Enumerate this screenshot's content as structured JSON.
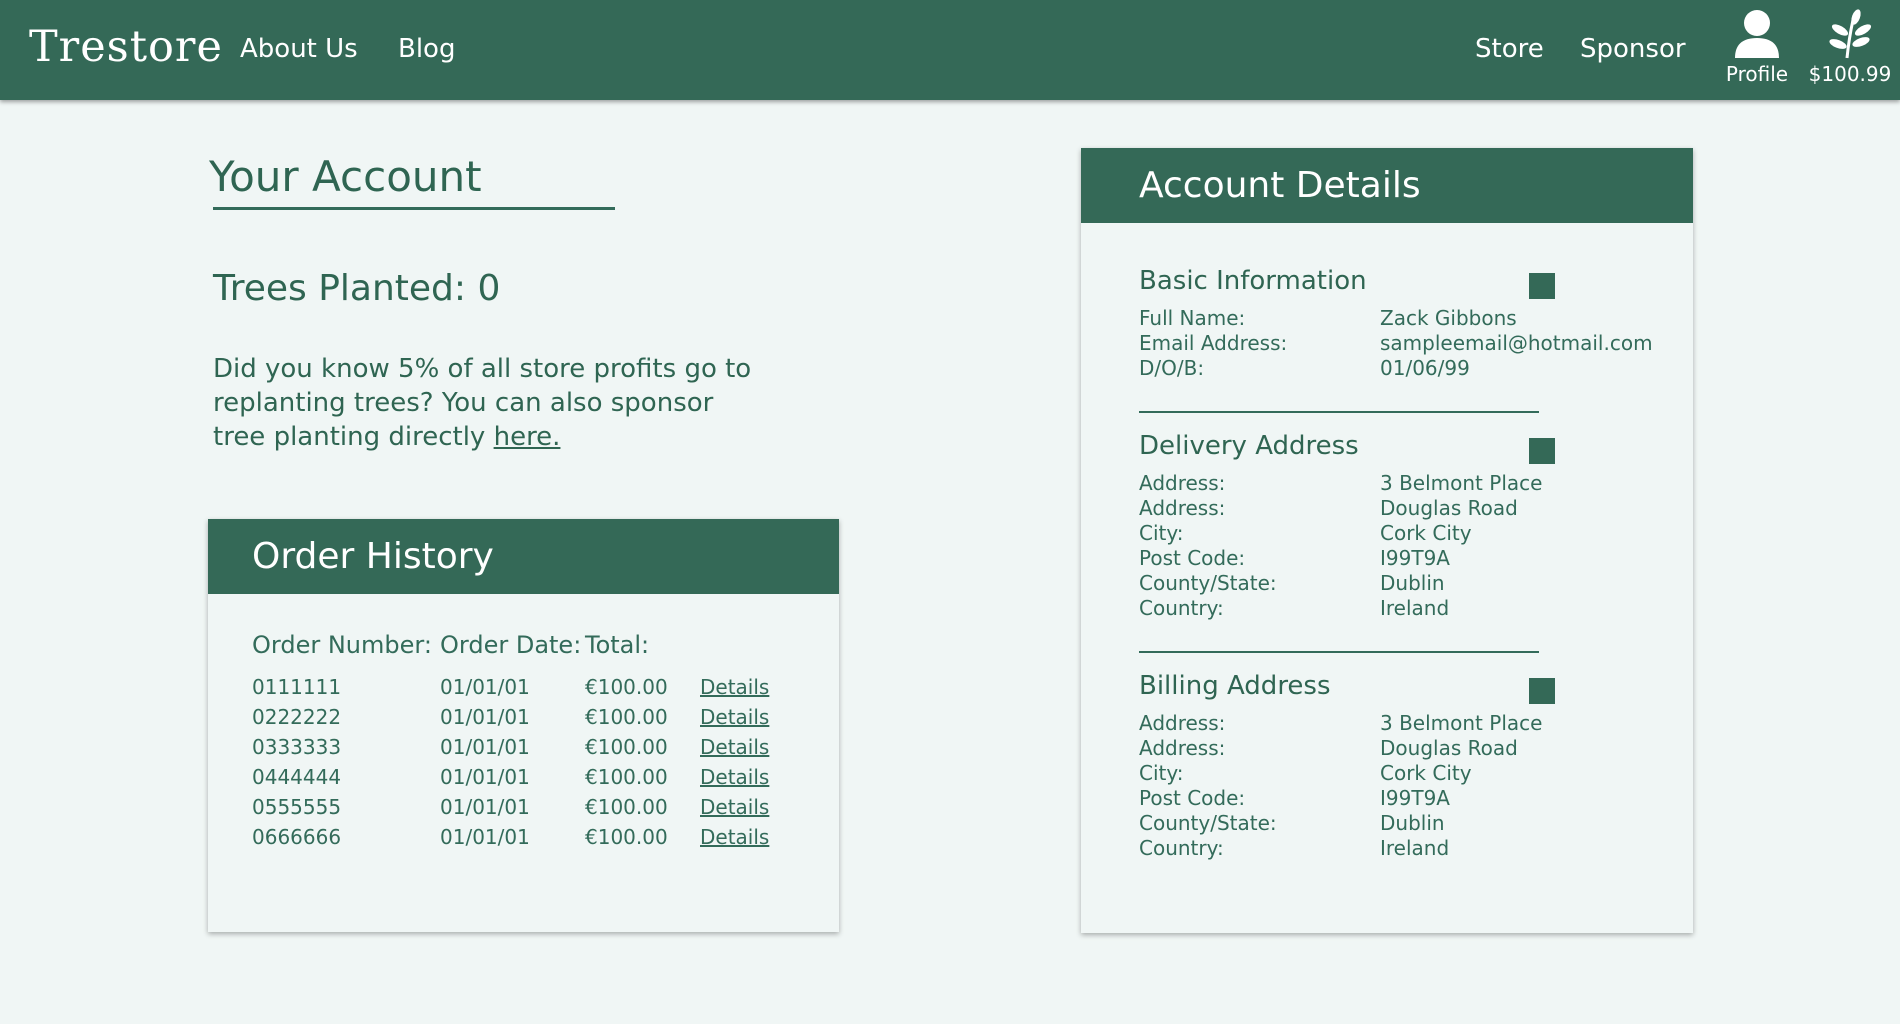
{
  "header": {
    "logo": "Trestore",
    "nav_left": [
      "About Us",
      "Blog"
    ],
    "nav_right": [
      "Store",
      "Sponsor"
    ],
    "profile_label": "Profile",
    "balance_label": "$100.99"
  },
  "account": {
    "title": "Your Account",
    "trees_planted": "Trees Planted: 0",
    "info_text": "Did you know 5% of all store profits go to replanting trees? You can also sponsor tree planting directly ",
    "info_link": "here."
  },
  "orders": {
    "title": "Order History",
    "headers": [
      "Order Number:",
      "Order Date:",
      "Total:"
    ],
    "details_label": "Details",
    "rows": [
      {
        "number": "0111111",
        "date": "01/01/01",
        "total": "€100.00"
      },
      {
        "number": "0222222",
        "date": "01/01/01",
        "total": "€100.00"
      },
      {
        "number": "0333333",
        "date": "01/01/01",
        "total": "€100.00"
      },
      {
        "number": "0444444",
        "date": "01/01/01",
        "total": "€100.00"
      },
      {
        "number": "0555555",
        "date": "01/01/01",
        "total": "€100.00"
      },
      {
        "number": "0666666",
        "date": "01/01/01",
        "total": "€100.00"
      }
    ]
  },
  "details": {
    "title": "Account Details",
    "sections": [
      {
        "title": "Basic Information",
        "fields": [
          {
            "label": "Full Name:",
            "value": "Zack Gibbons"
          },
          {
            "label": "Email Address:",
            "value": "sampleemail@hotmail.com"
          },
          {
            "label": "D/O/B:",
            "value": "01/06/99"
          }
        ]
      },
      {
        "title": "Delivery Address",
        "fields": [
          {
            "label": "Address:",
            "value": "3 Belmont Place"
          },
          {
            "label": "Address:",
            "value": "Douglas Road"
          },
          {
            "label": "City:",
            "value": "Cork City"
          },
          {
            "label": "Post Code:",
            "value": "I99T9A"
          },
          {
            "label": "County/State:",
            "value": "Dublin"
          },
          {
            "label": "Country:",
            "value": "Ireland"
          }
        ]
      },
      {
        "title": "Billing Address",
        "fields": [
          {
            "label": "Address:",
            "value": "3 Belmont Place"
          },
          {
            "label": "Address:",
            "value": "Douglas Road"
          },
          {
            "label": "City:",
            "value": "Cork City"
          },
          {
            "label": "Post Code:",
            "value": "I99T9A"
          },
          {
            "label": "County/State:",
            "value": "Dublin"
          },
          {
            "label": "Country:",
            "value": "Ireland"
          }
        ]
      }
    ]
  },
  "colors": {
    "brand": "#346957",
    "background": "#f0f6f5",
    "text": "#2f6552"
  },
  "icons": {
    "profile": "person-icon",
    "balance": "sprout-icon",
    "edit": "edit-square-icon"
  }
}
